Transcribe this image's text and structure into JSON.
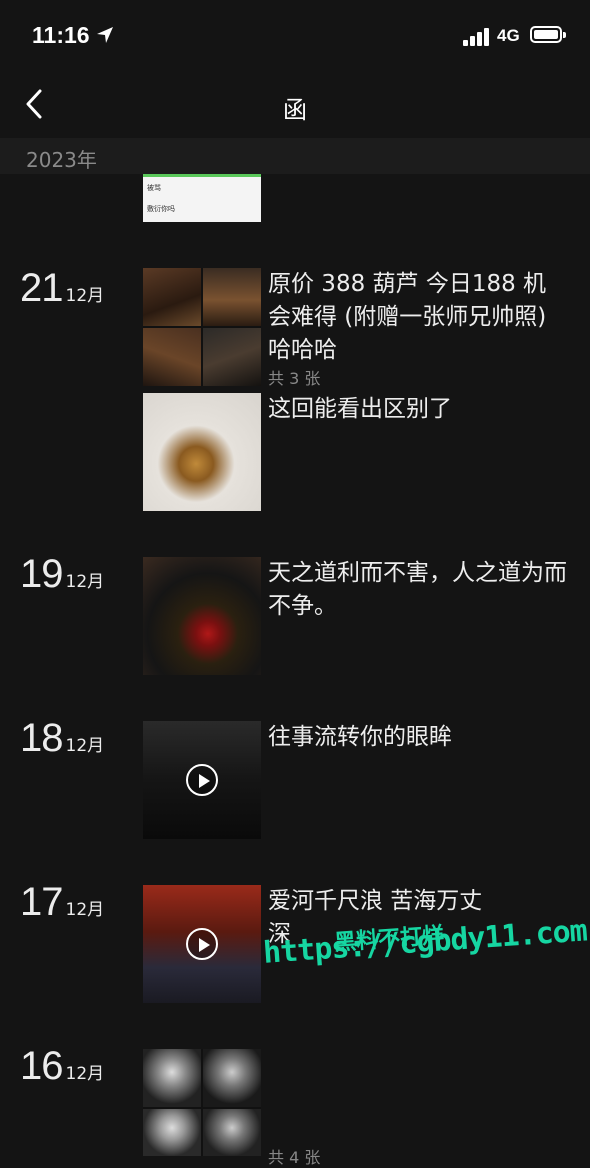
{
  "status_bar": {
    "time": "11:16",
    "network": "4G"
  },
  "nav": {
    "title": "函"
  },
  "year_label": "2023年",
  "preview_texts": [
    "被骂",
    "敷衍你吗"
  ],
  "entries": [
    {
      "day": "21",
      "month": "12月",
      "posts": [
        {
          "text": "原价 388 葫芦 今日188 机会难得 (附赠一张师兄帅照) 哈哈哈",
          "count": "共 3 张"
        },
        {
          "text": "这回能看出区别了"
        }
      ]
    },
    {
      "day": "19",
      "month": "12月",
      "posts": [
        {
          "text": "天之道利而不害，人之道为而不争。"
        }
      ]
    },
    {
      "day": "18",
      "month": "12月",
      "posts": [
        {
          "text": "往事流转你的眼眸"
        }
      ]
    },
    {
      "day": "17",
      "month": "12月",
      "posts": [
        {
          "text": "爱河千尺浪 苦海万丈深"
        }
      ]
    },
    {
      "day": "16",
      "month": "12月",
      "posts": [
        {
          "count": "共 4 张"
        }
      ]
    }
  ],
  "watermark": {
    "line1": "黑料不打烊",
    "line2": "https://cgbdy11.com"
  }
}
